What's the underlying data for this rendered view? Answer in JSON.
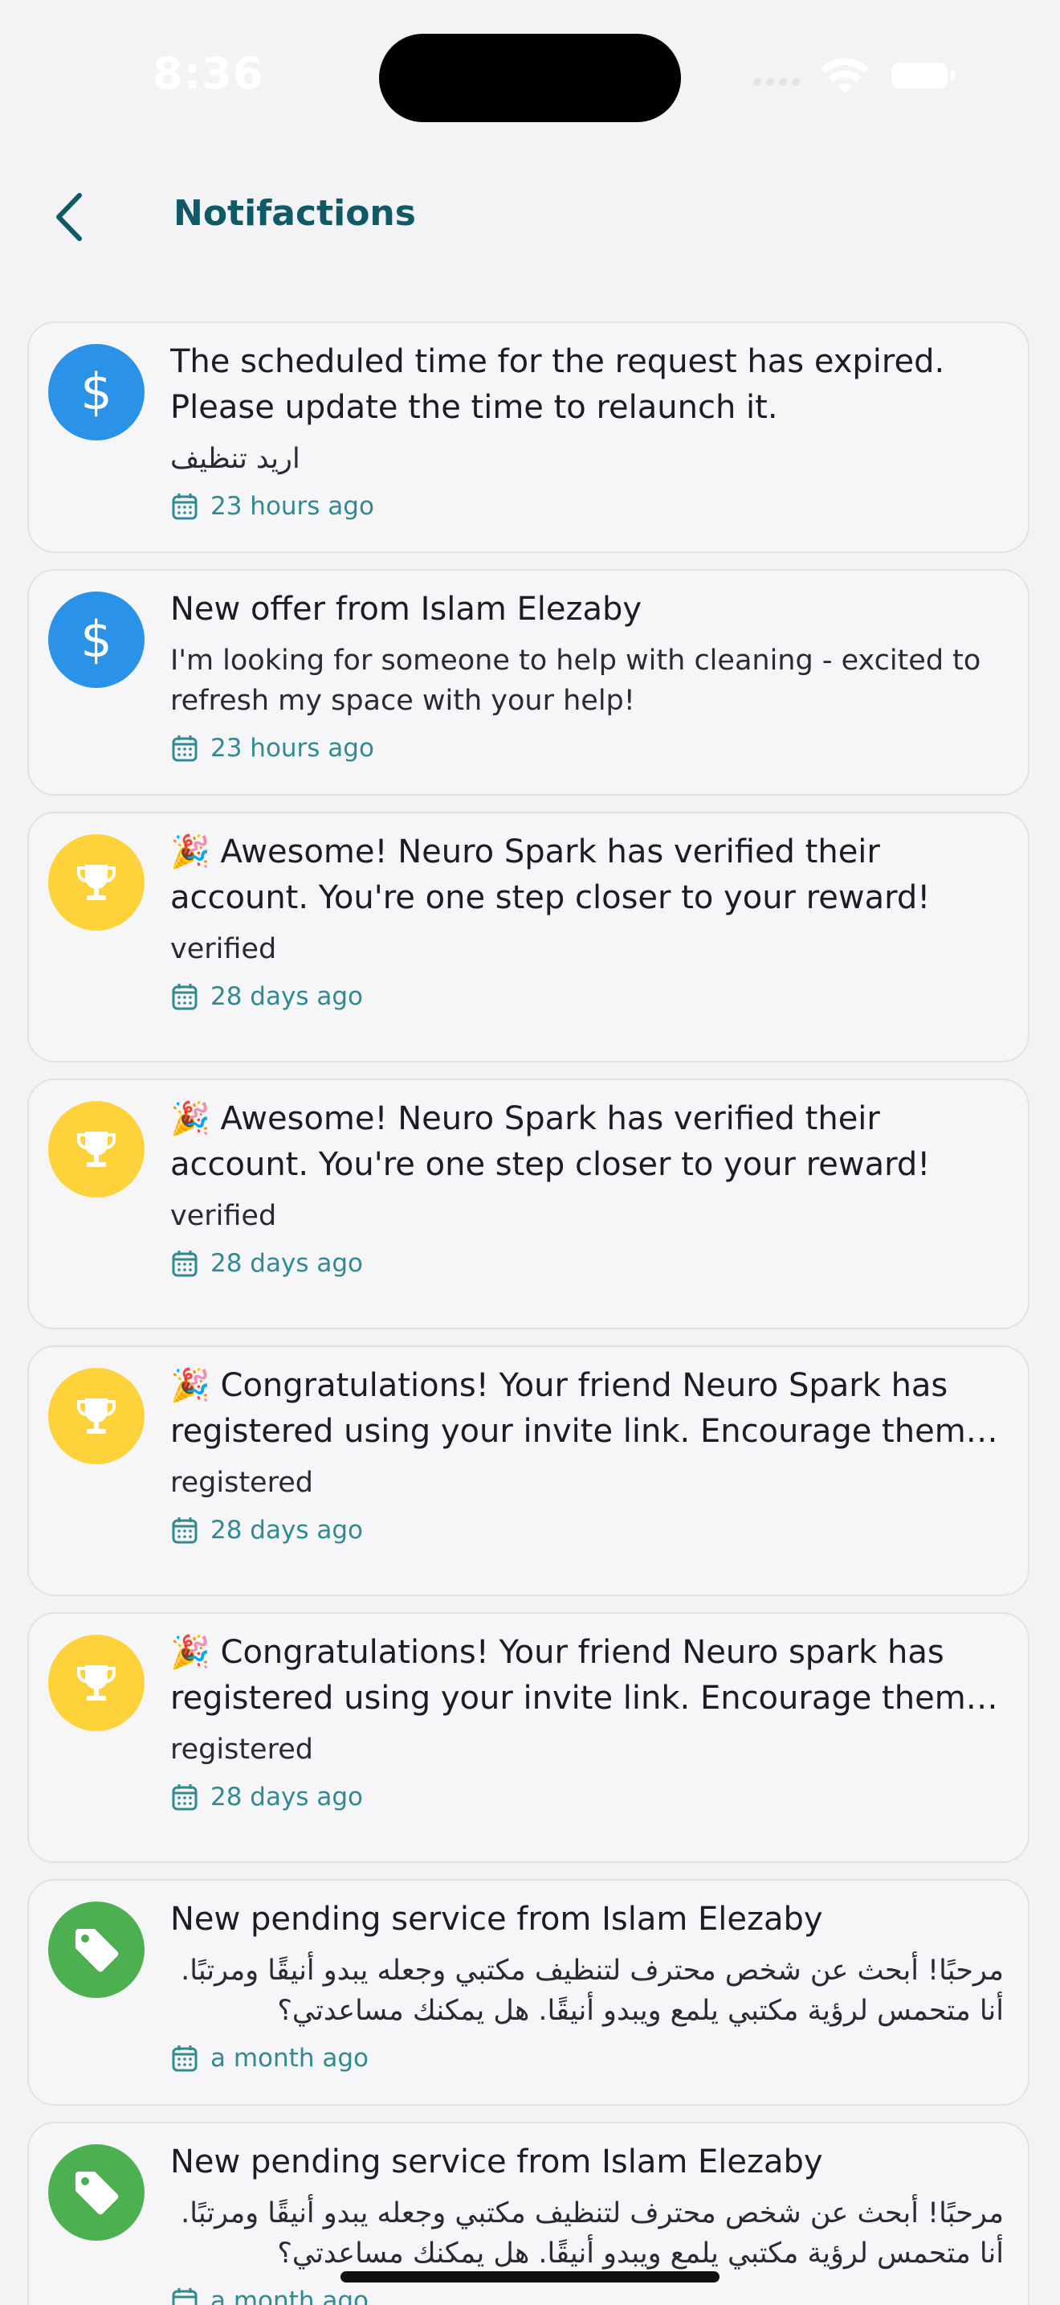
{
  "status_bar": {
    "time": "8:36"
  },
  "header": {
    "title": "Notifactions",
    "back_icon": "chevron-left-icon"
  },
  "colors": {
    "accent": "#0f5a66",
    "time_text": "#2f8a92",
    "money": "#2a93e8",
    "trophy": "#fdd23b",
    "tag": "#4caf50"
  },
  "notifications": [
    {
      "icon": "dollar-icon",
      "icon_color": "#2a93e8",
      "title": "The scheduled time for the request has expired. Please update the time to relaunch it.",
      "body": "اريد تنظيف",
      "time": "23 hours ago"
    },
    {
      "icon": "dollar-icon",
      "icon_color": "#2a93e8",
      "title": "New offer from Islam Elezaby",
      "body": "I'm looking for someone to help with cleaning - excited to refresh my space with your help!",
      "time": "23 hours ago"
    },
    {
      "icon": "trophy-icon",
      "icon_color": "#fdd23b",
      "emoji": "🎉",
      "title": "Awesome! Neuro Spark has verified their account. You're one step closer to your reward!",
      "body": "verified",
      "time": "28 days ago"
    },
    {
      "icon": "trophy-icon",
      "icon_color": "#fdd23b",
      "emoji": "🎉",
      "title": "Awesome! Neuro Spark has verified their account. You're one step closer to your reward!",
      "body": "verified",
      "time": "28 days ago"
    },
    {
      "icon": "trophy-icon",
      "icon_color": "#fdd23b",
      "emoji": "🎉",
      "title": "Congratulations! Your friend Neuro Spark has registered using your invite link. Encourage them to verify their account.",
      "body": "registered",
      "time": "28 days ago"
    },
    {
      "icon": "trophy-icon",
      "icon_color": "#fdd23b",
      "emoji": "🎉",
      "title": "Congratulations! Your friend Neuro spark  has registered using your invite link. Encourage them to verify their account.",
      "body": "registered",
      "time": "28 days ago"
    },
    {
      "icon": "tag-icon",
      "icon_color": "#4caf50",
      "title": "New pending service from Islam Elezaby",
      "body": "مرحبًا! أبحث عن شخص محترف لتنظيف مكتبي وجعله يبدو أنيقًا ومرتبًا. أنا متحمس لرؤية مكتبي يلمع ويبدو أنيقًا. هل يمكنك مساعدتي؟",
      "time": "a month ago"
    },
    {
      "icon": "tag-icon",
      "icon_color": "#4caf50",
      "title": "New pending service from Islam Elezaby",
      "body": "مرحبًا! أبحث عن شخص محترف لتنظيف مكتبي وجعله يبدو أنيقًا ومرتبًا. أنا متحمس لرؤية مكتبي يلمع ويبدو أنيقًا. هل يمكنك مساعدتي؟",
      "time": "a month ago"
    }
  ]
}
